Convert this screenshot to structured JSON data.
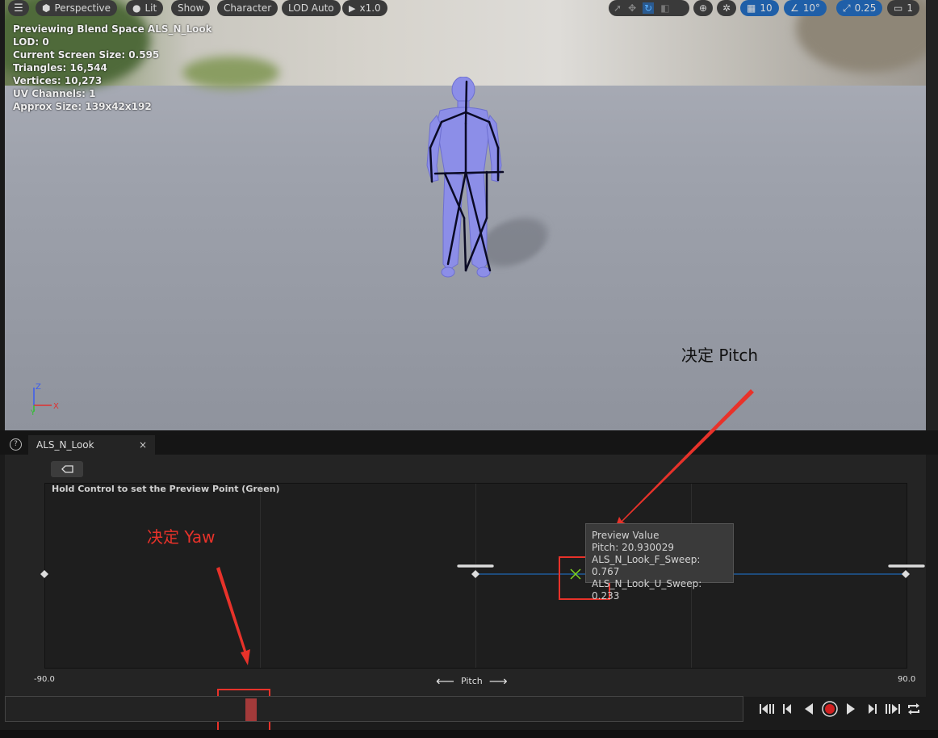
{
  "toolbar": {
    "perspective": "Perspective",
    "lit": "Lit",
    "show": "Show",
    "character": "Character",
    "lod": "LOD Auto",
    "speed": "x1.0",
    "grid_snap": "10",
    "angle_snap": "10°",
    "scale_snap": "0.25",
    "camera_speed": "1"
  },
  "stats": {
    "previewing": "Previewing Blend Space ALS_N_Look",
    "lod": "LOD: 0",
    "screen_size": "Current Screen Size: 0.595",
    "triangles": "Triangles: 16,544",
    "vertices": "Vertices: 10,273",
    "uv_channels": "UV Channels: 1",
    "approx_size": "Approx Size: 139x42x192"
  },
  "axis_gizmo": {
    "z": "Z",
    "x": "X",
    "y": "Y"
  },
  "annotations": {
    "pitch": "决定 Pitch",
    "yaw": "决定 Yaw"
  },
  "tab": {
    "title": "ALS_N_Look",
    "close": "×",
    "help": "?"
  },
  "blendspace": {
    "hint": "Hold Control to set the Preview Point (Green)",
    "axis_min": "-90.0",
    "axis_max": "90.0",
    "axis_label": "Pitch"
  },
  "tooltip": {
    "title": "Preview Value",
    "pitch": "Pitch: 20.930029",
    "sample_f": "ALS_N_Look_F_Sweep: 0.767",
    "sample_u": "ALS_N_Look_U_Sweep: 0.233"
  },
  "colors": {
    "accent": "#1f5fa8",
    "annotation": "#e8322a",
    "scrubber": "#a33a3a",
    "preview_point": "#7ed321"
  }
}
